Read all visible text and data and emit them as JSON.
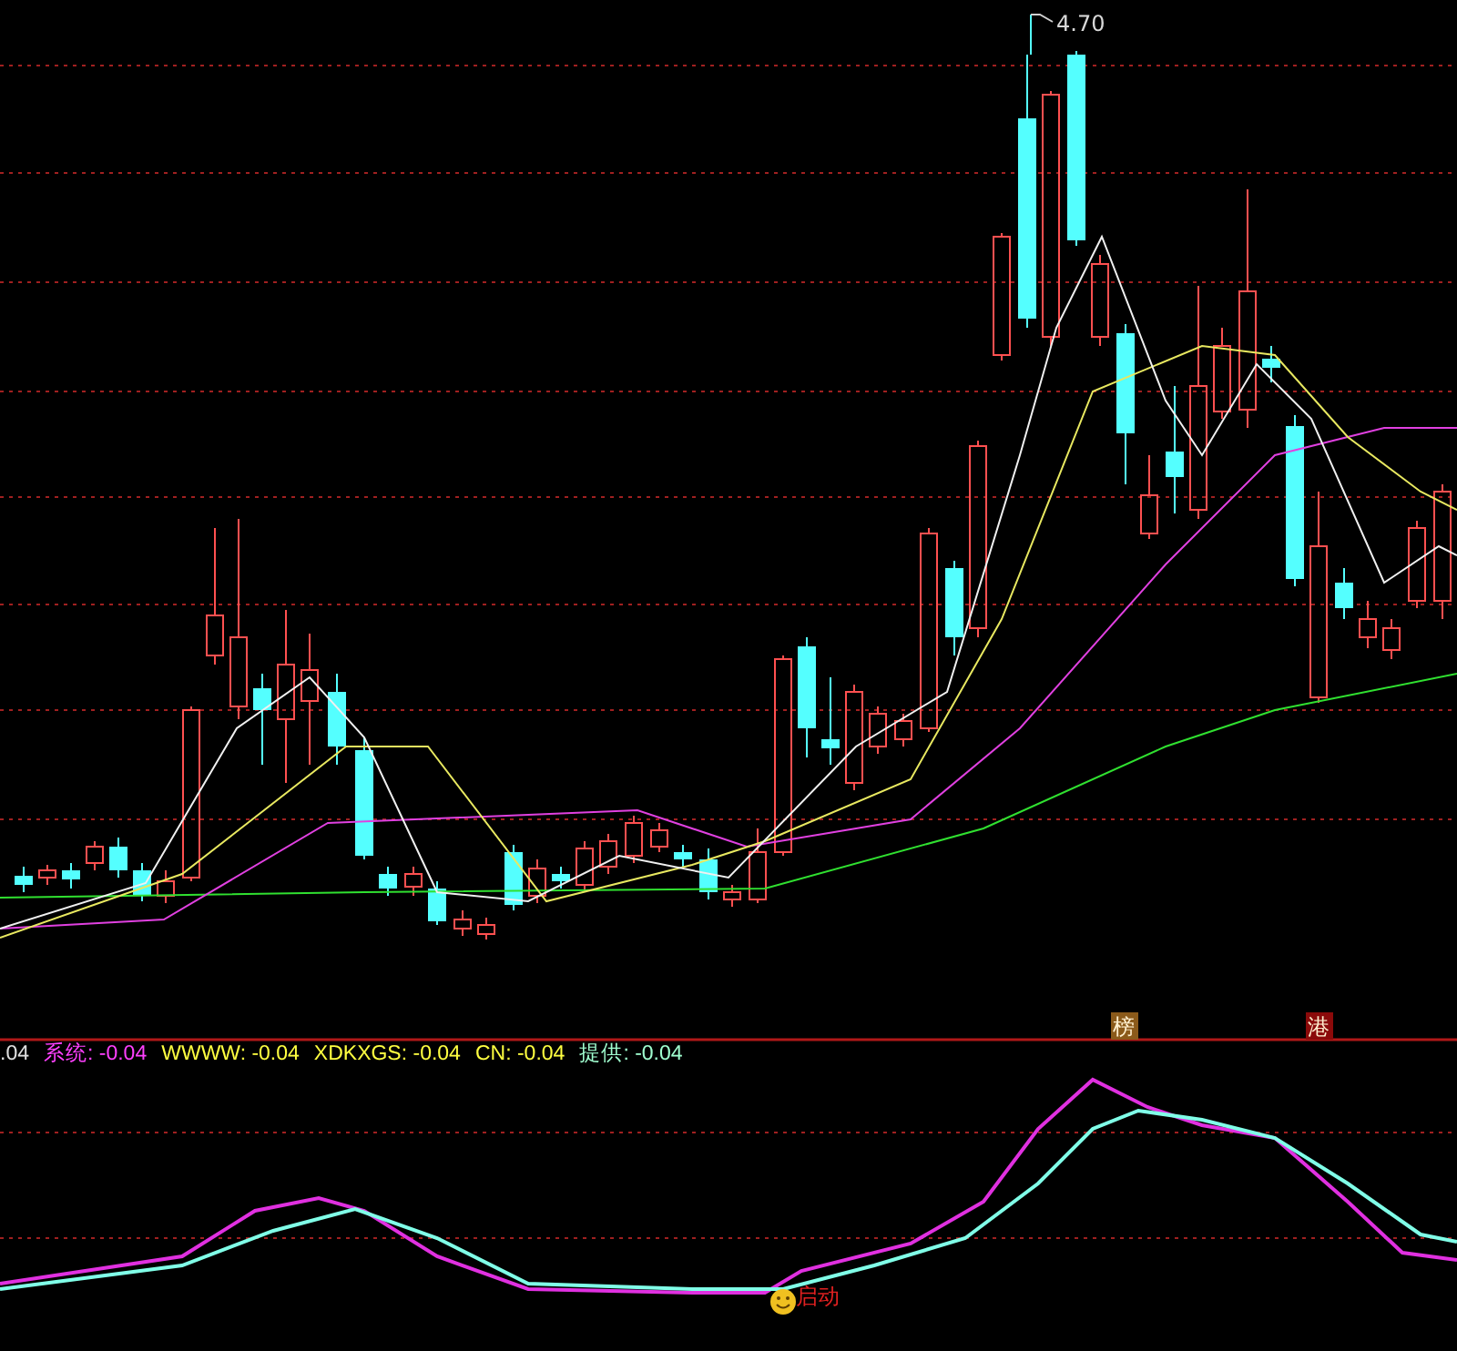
{
  "main_chart": {
    "high_marker": "4.70",
    "tags": [
      {
        "label": "榜",
        "color": "#8b5a1a"
      },
      {
        "label": "港",
        "color": "#8b0a0a"
      }
    ]
  },
  "indicator": {
    "legend": [
      {
        "text": ".04",
        "color": "#e0e0e0"
      },
      {
        "text": "系统: -0.04",
        "color": "#ff40ff"
      },
      {
        "text": "WWWW: -0.04",
        "color": "#ffff40"
      },
      {
        "text": "XDKXGS: -0.04",
        "color": "#ffff40"
      },
      {
        "text": "CN: -0.04",
        "color": "#ffff40"
      },
      {
        "text": "提供: -0.04",
        "color": "#a0ffd0"
      }
    ],
    "signal": {
      "label": "启动"
    }
  }
}
